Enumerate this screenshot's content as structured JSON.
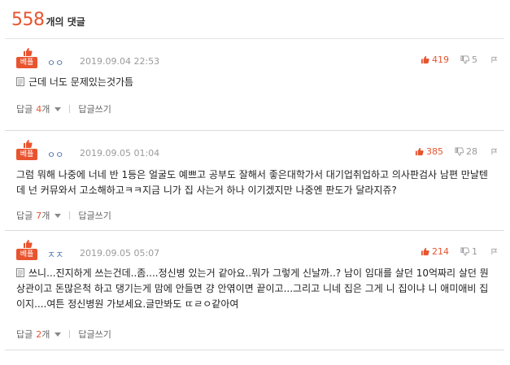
{
  "header": {
    "count": "558",
    "label": "개의 댓글"
  },
  "best_label": "베플",
  "comments": [
    {
      "nick": "ㅇㅇ",
      "date": "2019.09.04 22:53",
      "up": "419",
      "down": "5",
      "text": "근데 너도 문제있는것가틈",
      "reply_label": "답글",
      "reply_count": "4",
      "reply_unit": "개",
      "write_label": "답글쓰기"
    },
    {
      "nick": "ㅇㅇ",
      "date": "2019.09.05 01:04",
      "up": "385",
      "down": "28",
      "text": "그럼 뭐해 나중에 너네 반 1등은 얼굴도 예쁘고 공부도 잘해서 좋은대학가서 대기업취업하고 의사판검사 남편 만날텐데 넌 커뮤와서 고소해하고ㅋㅋ지금 니가 집 사는거 하나 이기겠지만 나중엔 판도가 달라지쥬?",
      "reply_label": "답글",
      "reply_count": "7",
      "reply_unit": "개",
      "write_label": "답글쓰기"
    },
    {
      "nick": "ㅈㅈ",
      "date": "2019.09.05 05:07",
      "up": "214",
      "down": "1",
      "text": "쓰니...진지하게 쓰는건데..좀....정신병 있는거 같아요..뭐가 그렇게 신날까..? 남이 임대를 살던 10억짜리 살던 뭔상관이고 돈많은척 하고 댕기는게 맘에 안들면 걍 안엮이면 끝이고...그리고 니네 집은 그게 니 집이냐 니 애미애비 집이지....여튼 정신병원 가보세요.글만봐도 ㄸㄹㅇ같아여",
      "reply_label": "답글",
      "reply_count": "2",
      "reply_unit": "개",
      "write_label": "답글쓰기"
    }
  ],
  "colors": {
    "accent": "#e8542f",
    "nick": "#4a6ea9",
    "muted": "#9a9a9a"
  }
}
